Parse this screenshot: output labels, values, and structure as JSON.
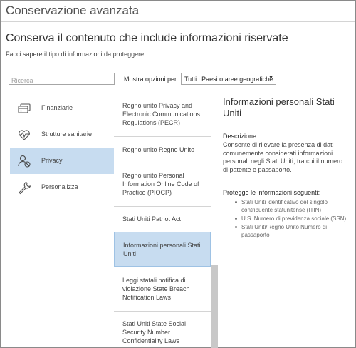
{
  "window": {
    "title": "Conservazione avanzata"
  },
  "header": {
    "headline": "Conserva il contenuto che include informazioni riservate",
    "subtitle": "Facci sapere il tipo di informazioni da proteggere."
  },
  "toolbar": {
    "search_placeholder": "Ricerca",
    "filter_label": "Mostra opzioni per",
    "filter_value": "Tutti i Paesi o aree geografiche"
  },
  "categories": [
    {
      "label": "Finanziarie",
      "icon": "credit-card-icon",
      "selected": false
    },
    {
      "label": "Strutture sanitarie",
      "icon": "heartbeat-icon",
      "selected": false
    },
    {
      "label": "Privacy",
      "icon": "privacy-person-icon",
      "selected": true
    },
    {
      "label": "Personalizza",
      "icon": "wrench-icon",
      "selected": false
    }
  ],
  "templates": [
    {
      "label": "Regno unito Privacy and Electronic Communications Regulations (PECR)",
      "selected": false
    },
    {
      "label": "Regno unito Regno Unito",
      "selected": false
    },
    {
      "label": "Regno unito Personal Information Online Code of Practice (PIOCP)",
      "selected": false
    },
    {
      "label": "Stati Uniti Patriot Act",
      "selected": false
    },
    {
      "label": "Informazioni personali Stati Uniti",
      "selected": true
    },
    {
      "label": "Leggi statali notifica di violazione State Breach Notification Laws",
      "selected": false
    },
    {
      "label": "Stati Uniti State Social Security Number Confidentiality Laws",
      "selected": false
    }
  ],
  "detail": {
    "title": "Informazioni personali Stati Uniti",
    "description_heading": "Descrizione",
    "description": "Consente di rilevare la presenza di dati comunemente considerati informazioni personali negli Stati Uniti, tra cui il numero di patente e passaporto.",
    "protects_heading": "Protegge le informazioni seguenti:",
    "protects": [
      "Stati Uniti identificativo del singolo contribuente statunitense (ITIN)",
      "U.S. Numero di previdenza sociale (SSN)",
      "Stati Uniti/Regno Unito Numero di passaporto"
    ]
  },
  "colors": {
    "selected_background": "#c7dcf0",
    "border": "#8a8a8a"
  }
}
